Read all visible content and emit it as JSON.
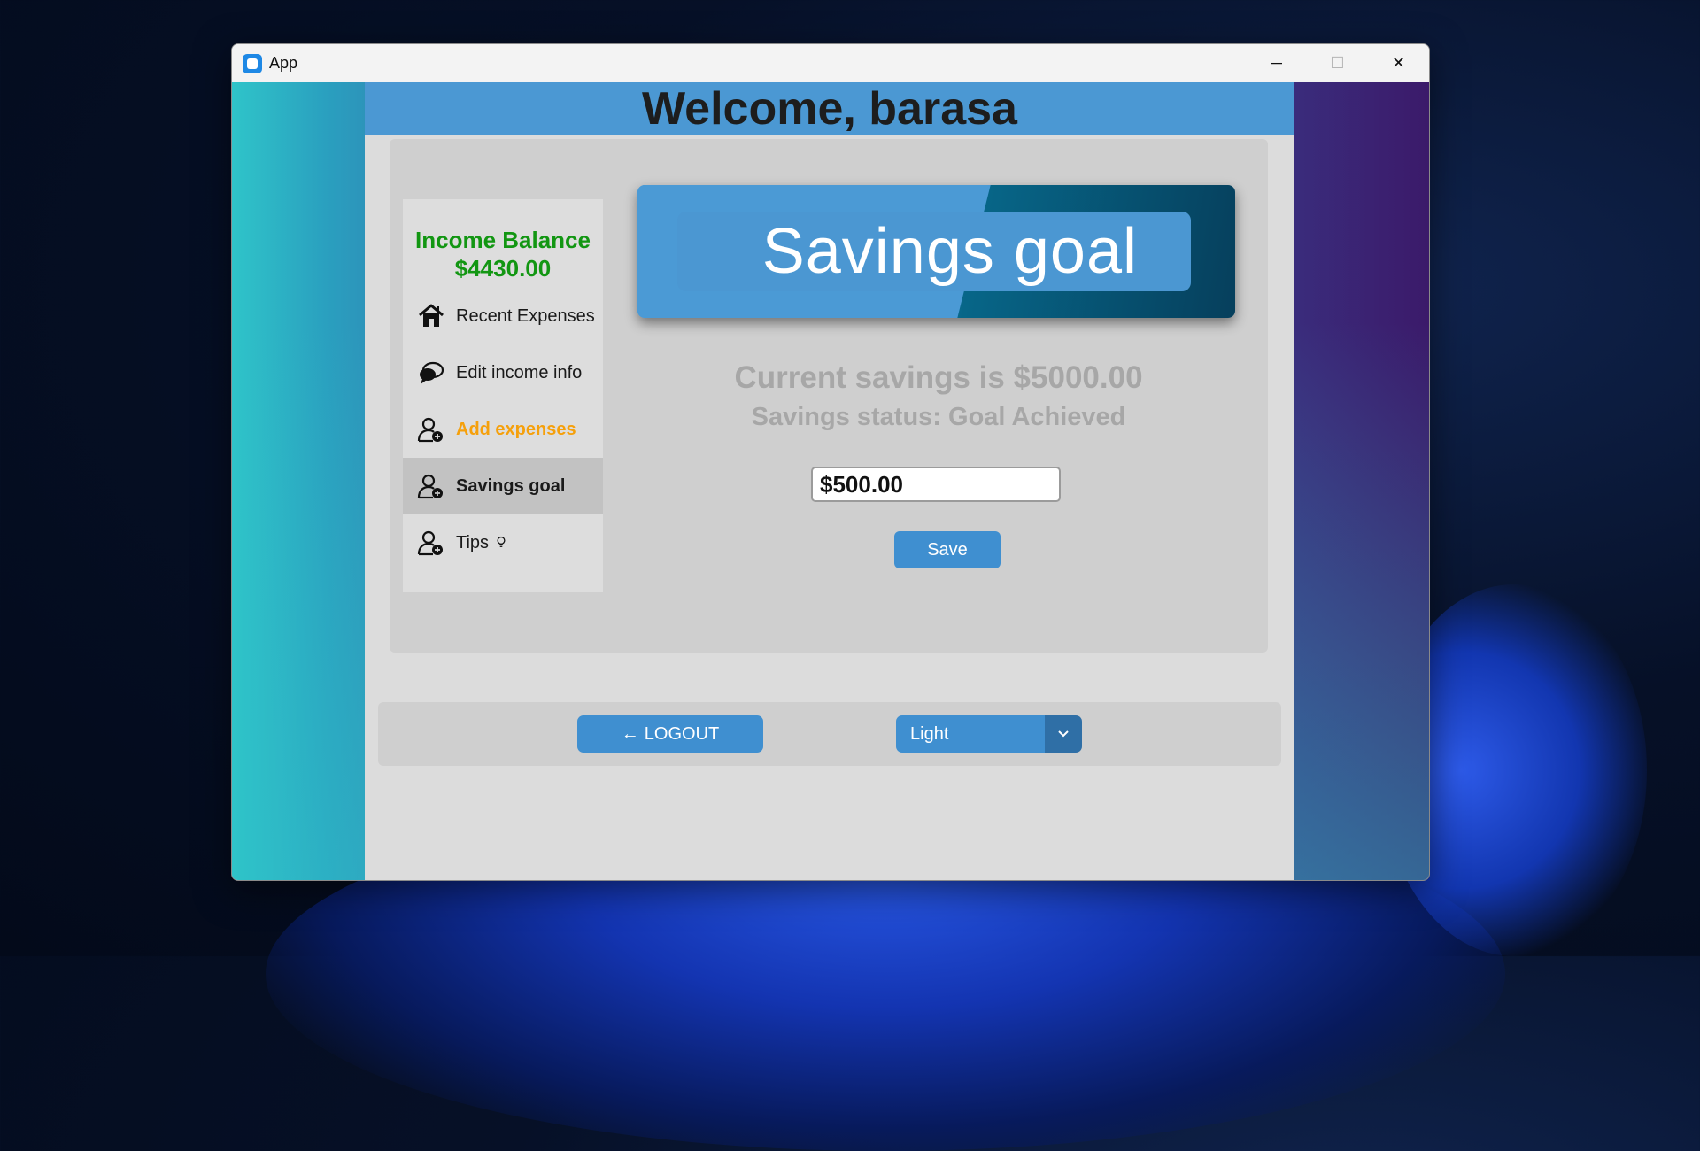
{
  "window": {
    "title": "App",
    "controls": {
      "minimize": "─",
      "maximize": "☐",
      "close": "✕"
    }
  },
  "header": {
    "title": "Welcome, barasa"
  },
  "sidebar": {
    "balance_label": "Income Balance",
    "balance_value": "$4430.00",
    "items": [
      {
        "label": "Recent Expenses",
        "icon": "home-icon"
      },
      {
        "label": "Edit income info",
        "icon": "chat-icon"
      },
      {
        "label": "Add expenses",
        "icon": "user-add-icon",
        "color": "#f5a00c"
      },
      {
        "label": "Savings goal",
        "icon": "user-add-icon",
        "active": true
      },
      {
        "label": "Tips",
        "icon": "user-add-icon"
      }
    ]
  },
  "main": {
    "banner_title": "Savings goal",
    "current_savings": "Current savings is $5000.00",
    "savings_status": "Savings status: Goal Achieved",
    "goal_input_value": "$500.00",
    "save_label": "Save"
  },
  "bottom": {
    "logout_label": "LOGOUT",
    "theme_value": "Light"
  },
  "colors": {
    "accent_blue": "#3f8fd0",
    "header_blue": "#4b98d3",
    "balance_green": "#129612",
    "orange": "#f5a00c"
  }
}
